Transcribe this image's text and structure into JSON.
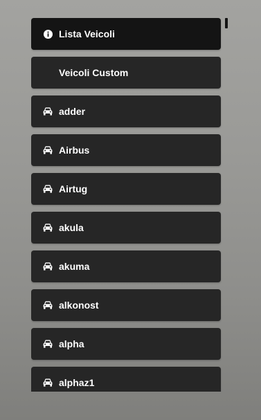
{
  "menu": {
    "header": {
      "label": "Lista Veicoli",
      "icon": "info-circle-icon"
    },
    "custom": {
      "label": "Veicoli Custom"
    },
    "vehicles": [
      {
        "label": "adder",
        "icon": "car-icon"
      },
      {
        "label": "Airbus",
        "icon": "car-icon"
      },
      {
        "label": "Airtug",
        "icon": "car-icon"
      },
      {
        "label": "akula",
        "icon": "car-icon"
      },
      {
        "label": "akuma",
        "icon": "car-icon"
      },
      {
        "label": "alkonost",
        "icon": "car-icon"
      },
      {
        "label": "alpha",
        "icon": "car-icon"
      },
      {
        "label": "alphaz1",
        "icon": "car-icon"
      }
    ]
  },
  "colors": {
    "item_bg": "#262626",
    "header_bg": "#141414",
    "text": "#ffffff"
  }
}
